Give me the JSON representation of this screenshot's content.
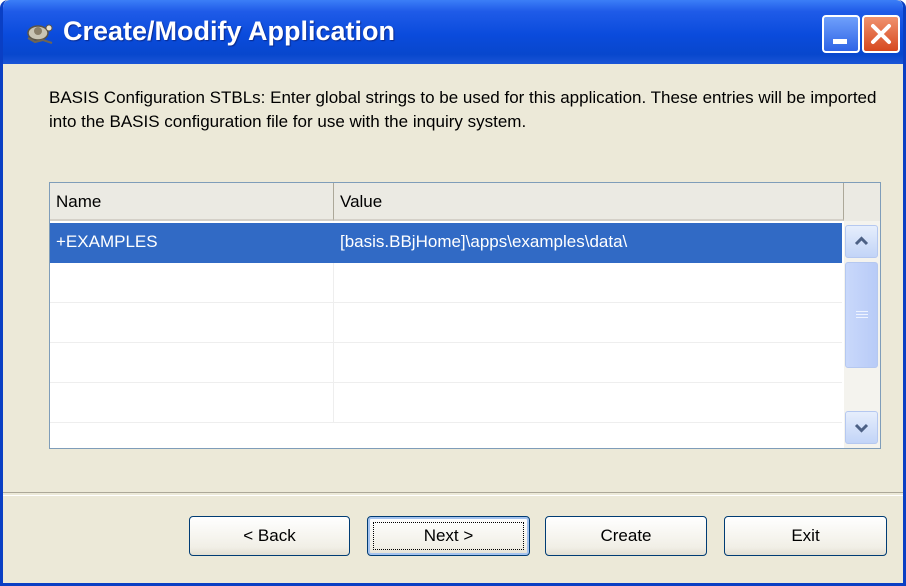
{
  "window": {
    "title": "Create/Modify Application",
    "icons": {
      "app": "application-icon",
      "minimize": "minimize-icon",
      "close": "close-icon"
    }
  },
  "description": "BASIS Configuration STBLs: Enter global strings to be used for this application.  These entries will be imported into the BASIS configuration file for use with the inquiry system.",
  "grid": {
    "columns": [
      "Name",
      "Value"
    ],
    "rows": [
      {
        "name": "+EXAMPLES",
        "value": "[basis.BBjHome]\\apps\\examples\\data\\",
        "selected": true
      },
      {
        "name": "",
        "value": ""
      },
      {
        "name": "",
        "value": ""
      },
      {
        "name": "",
        "value": ""
      },
      {
        "name": "",
        "value": ""
      }
    ]
  },
  "buttons": {
    "back": "< Back",
    "next": "Next >",
    "create": "Create",
    "exit": "Exit"
  },
  "colors": {
    "titlebar": "#0a4bdc",
    "selection": "#316ac5",
    "dialog_bg": "#ece9d8"
  }
}
